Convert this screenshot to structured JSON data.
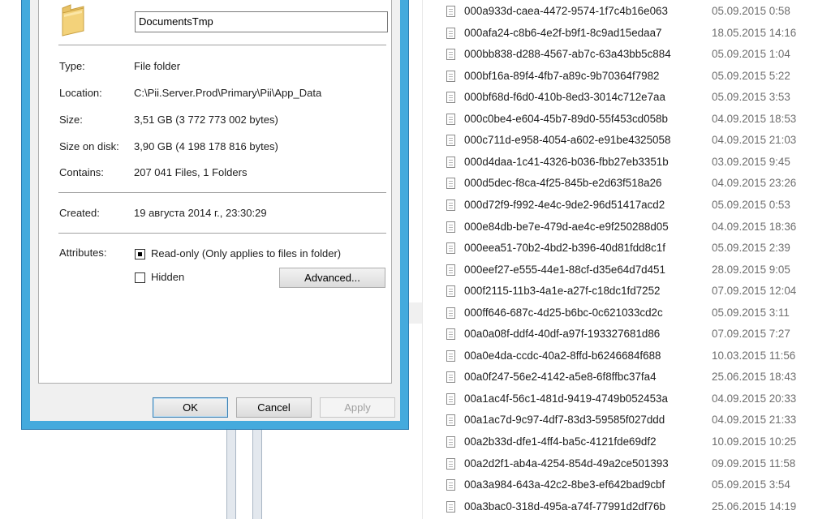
{
  "dialog": {
    "name": "DocumentsTmp",
    "type_label": "Type:",
    "type_value": "File folder",
    "location_label": "Location:",
    "location_value": "C:\\Pii.Server.Prod\\Primary\\Pii\\App_Data",
    "size_label": "Size:",
    "size_value": "3,51 GB (3 772 773 002 bytes)",
    "size_on_disk_label": "Size on disk:",
    "size_on_disk_value": "3,90 GB (4 198 178 816 bytes)",
    "contains_label": "Contains:",
    "contains_value": "207 041 Files, 1 Folders",
    "created_label": "Created:",
    "created_value": "19 августа 2014 г., 23:30:29",
    "attributes_label": "Attributes:",
    "readonly_label": "Read-only (Only applies to files in folder)",
    "hidden_label": "Hidden",
    "advanced_label": "Advanced...",
    "ok_label": "OK",
    "cancel_label": "Cancel",
    "apply_label": "Apply"
  },
  "files": [
    {
      "name": "000a933d-caea-4472-9574-1f7c4b16e063",
      "date": "05.09.2015 0:58"
    },
    {
      "name": "000afa24-c8b6-4e2f-b9f1-8c9ad15edaa7",
      "date": "18.05.2015 14:16"
    },
    {
      "name": "000bb838-d288-4567-ab7c-63a43bb5c884",
      "date": "05.09.2015 1:04"
    },
    {
      "name": "000bf16a-89f4-4fb7-a89c-9b70364f7982",
      "date": "05.09.2015 5:22"
    },
    {
      "name": "000bf68d-f6d0-410b-8ed3-3014c712e7aa",
      "date": "05.09.2015 3:53"
    },
    {
      "name": "000c0be4-e604-45b7-89d0-55f453cd058b",
      "date": "04.09.2015 18:53"
    },
    {
      "name": "000c711d-e958-4054-a602-e91be4325058",
      "date": "04.09.2015 21:03"
    },
    {
      "name": "000d4daa-1c41-4326-b036-fbb27eb3351b",
      "date": "03.09.2015 9:45"
    },
    {
      "name": "000d5dec-f8ca-4f25-845b-e2d63f518a26",
      "date": "04.09.2015 23:26"
    },
    {
      "name": "000d72f9-f992-4e4c-9de2-96d51417acd2",
      "date": "05.09.2015 0:53"
    },
    {
      "name": "000e84db-be7e-479d-ae4c-e9f250288d05",
      "date": "04.09.2015 18:36"
    },
    {
      "name": "000eea51-70b2-4bd2-b396-40d81fdd8c1f",
      "date": "05.09.2015 2:39"
    },
    {
      "name": "000eef27-e555-44e1-88cf-d35e64d7d451",
      "date": "28.09.2015 9:05"
    },
    {
      "name": "000f2115-11b3-4a1e-a27f-c18dc1fd7252",
      "date": "07.09.2015 12:04"
    },
    {
      "name": "000ff646-687c-4d25-b6bc-0c621033cd2c",
      "date": "05.09.2015 3:11"
    },
    {
      "name": "00a0a08f-ddf4-40df-a97f-193327681d86",
      "date": "07.09.2015 7:27"
    },
    {
      "name": "00a0e4da-ccdc-40a2-8ffd-b6246684f688",
      "date": "10.03.2015 11:56"
    },
    {
      "name": "00a0f247-56e2-4142-a5e8-6f8ffbc37fa4",
      "date": "25.06.2015 18:43"
    },
    {
      "name": "00a1ac4f-56c1-481d-9419-4749b052453a",
      "date": "04.09.2015 20:33"
    },
    {
      "name": "00a1ac7d-9c97-4df7-83d3-59585f027ddd",
      "date": "04.09.2015 21:33"
    },
    {
      "name": "00a2b33d-dfe1-4ff4-ba5c-4121fde69df2",
      "date": "10.09.2015 10:25"
    },
    {
      "name": "00a2d2f1-ab4a-4254-854d-49a2ce501393",
      "date": "09.09.2015 11:58"
    },
    {
      "name": "00a3a984-643a-42c2-8be3-ef642bad9cbf",
      "date": "05.09.2015 3:54"
    },
    {
      "name": "00a3bac0-318d-495a-a74f-77991d2df76b",
      "date": "25.06.2015 14:19"
    }
  ]
}
